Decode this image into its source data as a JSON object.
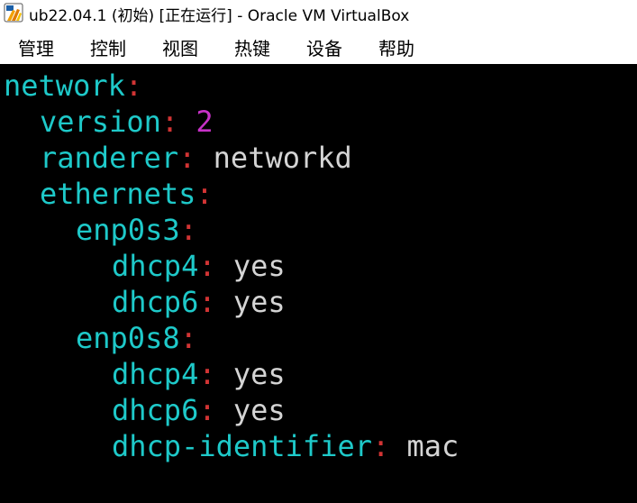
{
  "window": {
    "title": "ub22.04.1 (初始) [正在运行] - Oracle VM VirtualBox"
  },
  "menu": [
    "管理",
    "控制",
    "视图",
    "热键",
    "设备",
    "帮助"
  ],
  "colors": {
    "key": "#1ec9c9",
    "colon": "#d23434",
    "number": "#c832c8",
    "value": "#d4d4d4",
    "background": "#000000"
  },
  "terminal": {
    "lines": [
      {
        "indent": 0,
        "key": "network",
        "colon": ":",
        "value": "",
        "value_type": ""
      },
      {
        "indent": 2,
        "key": "version",
        "colon": ":",
        "value": "2",
        "value_type": "number"
      },
      {
        "indent": 2,
        "key": "randerer",
        "colon": ":",
        "value": "networkd",
        "value_type": "text"
      },
      {
        "indent": 2,
        "key": "ethernets",
        "colon": ":",
        "value": "",
        "value_type": ""
      },
      {
        "indent": 4,
        "key": "enp0s3",
        "colon": ":",
        "value": "",
        "value_type": ""
      },
      {
        "indent": 6,
        "key": "dhcp4",
        "colon": ":",
        "value": "yes",
        "value_type": "text"
      },
      {
        "indent": 6,
        "key": "dhcp6",
        "colon": ":",
        "value": "yes",
        "value_type": "text"
      },
      {
        "indent": 4,
        "key": "enp0s8",
        "colon": ":",
        "value": "",
        "value_type": ""
      },
      {
        "indent": 6,
        "key": "dhcp4",
        "colon": ":",
        "value": "yes",
        "value_type": "text"
      },
      {
        "indent": 6,
        "key": "dhcp6",
        "colon": ":",
        "value": "yes",
        "value_type": "text"
      },
      {
        "indent": 6,
        "key": "dhcp-identifier",
        "colon": ":",
        "value": "mac",
        "value_type": "text"
      }
    ]
  }
}
